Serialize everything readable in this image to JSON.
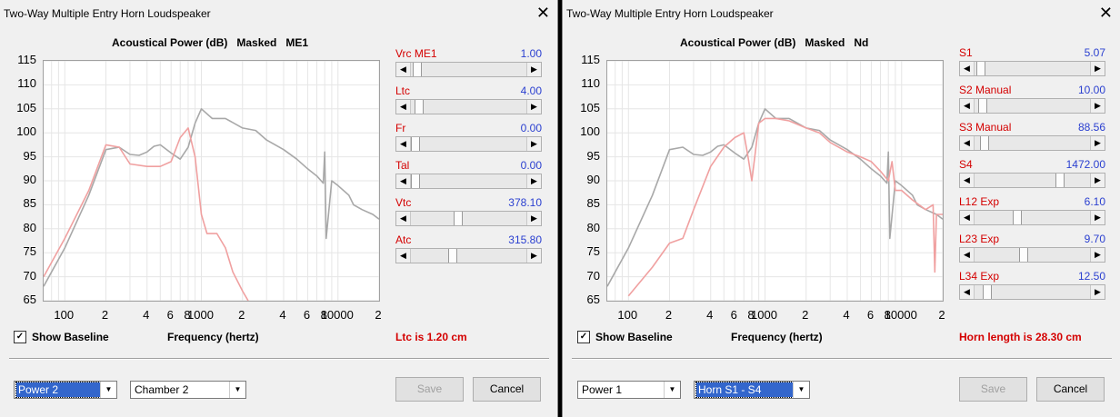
{
  "windows": [
    {
      "title": "Two-Way Multiple Entry Horn Loudspeaker",
      "chart_title": "Acoustical Power (dB)   Masked   ME1",
      "params": [
        {
          "label": "Vrc  ME1",
          "value": "1.00",
          "pos": 0.02
        },
        {
          "label": "Ltc",
          "value": "4.00",
          "pos": 0.03
        },
        {
          "label": "Fr",
          "value": "0.00",
          "pos": 0.0
        },
        {
          "label": "Tal",
          "value": "0.00",
          "pos": 0.0
        },
        {
          "label": "Vtc",
          "value": "378.10",
          "pos": 0.4
        },
        {
          "label": "Atc",
          "value": "315.80",
          "pos": 0.35
        }
      ],
      "show_baseline_label": "Show Baseline",
      "show_baseline_checked": true,
      "freq_label": "Frequency (hertz)",
      "status": "Ltc is 1.20 cm",
      "combo1": "Power 2",
      "combo2": "Chamber 2",
      "save_label": "Save",
      "cancel_label": "Cancel"
    },
    {
      "title": "Two-Way Multiple Entry Horn Loudspeaker",
      "chart_title": "Acoustical Power (dB)   Masked   Nd",
      "params": [
        {
          "label": "S1",
          "value": "5.07",
          "pos": 0.02
        },
        {
          "label": "S2  Manual",
          "value": "10.00",
          "pos": 0.03
        },
        {
          "label": "S3  Manual",
          "value": "88.56",
          "pos": 0.05
        },
        {
          "label": "S4",
          "value": "1472.00",
          "pos": 0.76
        },
        {
          "label": "L12  Exp",
          "value": "6.10",
          "pos": 0.36
        },
        {
          "label": "L23  Exp",
          "value": "9.70",
          "pos": 0.42
        },
        {
          "label": "L34  Exp",
          "value": "12.50",
          "pos": 0.08
        }
      ],
      "show_baseline_label": "Show Baseline",
      "show_baseline_checked": true,
      "freq_label": "Frequency (hertz)",
      "status": "Horn length is 28.30 cm",
      "combo1": "Power 1",
      "combo2": "Horn S1 - S4",
      "save_label": "Save",
      "cancel_label": "Cancel"
    }
  ],
  "chart_data": [
    {
      "type": "line",
      "title": "Acoustical Power (dB)   Masked   ME1",
      "xlabel": "Frequency (hertz)",
      "ylabel": "",
      "x_scale": "log",
      "xlim": [
        70,
        20000
      ],
      "ylim": [
        65,
        115
      ],
      "yticks": [
        115,
        110,
        105,
        100,
        95,
        90,
        85,
        80,
        75,
        70,
        65
      ],
      "xtick_labels": [
        "100",
        "2",
        "4",
        "6",
        "8",
        "1000",
        "2",
        "4",
        "6",
        "8",
        "10000",
        "2"
      ],
      "xtick_values": [
        100,
        200,
        400,
        600,
        800,
        1000,
        2000,
        4000,
        6000,
        8000,
        10000,
        20000
      ],
      "grid": true,
      "series": [
        {
          "color": "#a8a8a8",
          "x": [
            70,
            100,
            150,
            200,
            250,
            300,
            350,
            400,
            450,
            500,
            600,
            700,
            800,
            900,
            1000,
            1200,
            1500,
            2000,
            2500,
            3000,
            4000,
            5000,
            6000,
            7000,
            7800,
            8000,
            8200,
            9000,
            10000,
            12000,
            13000,
            15000,
            18000,
            20000
          ],
          "y": [
            68,
            76,
            87,
            96.5,
            97,
            95.5,
            95.3,
            96,
            97.2,
            97.5,
            95.8,
            94.5,
            97,
            102,
            105,
            103,
            103,
            101,
            100.5,
            98.5,
            96.5,
            94.5,
            92.5,
            91,
            89.5,
            96,
            78,
            90,
            89,
            87,
            85,
            84,
            83,
            82
          ]
        },
        {
          "color": "#f0a0a0",
          "x": [
            70,
            100,
            150,
            200,
            250,
            300,
            400,
            500,
            600,
            700,
            800,
            900,
            1000,
            1100,
            1300,
            1500,
            1700,
            2000,
            2200
          ],
          "y": [
            70,
            78,
            88,
            97.5,
            97,
            93.5,
            93,
            93,
            94,
            99,
            101,
            95,
            83,
            79,
            79,
            76,
            71,
            67,
            65
          ]
        }
      ]
    },
    {
      "type": "line",
      "title": "Acoustical Power (dB)   Masked   Nd",
      "xlabel": "Frequency (hertz)",
      "ylabel": "",
      "x_scale": "log",
      "xlim": [
        70,
        20000
      ],
      "ylim": [
        65,
        115
      ],
      "yticks": [
        115,
        110,
        105,
        100,
        95,
        90,
        85,
        80,
        75,
        70,
        65
      ],
      "xtick_labels": [
        "100",
        "2",
        "4",
        "6",
        "8",
        "1000",
        "2",
        "4",
        "6",
        "8",
        "10000",
        "2"
      ],
      "xtick_values": [
        100,
        200,
        400,
        600,
        800,
        1000,
        2000,
        4000,
        6000,
        8000,
        10000,
        20000
      ],
      "grid": true,
      "series": [
        {
          "color": "#a8a8a8",
          "x": [
            70,
            100,
            150,
            200,
            250,
            300,
            350,
            400,
            450,
            500,
            600,
            700,
            800,
            900,
            1000,
            1200,
            1500,
            2000,
            2500,
            3000,
            4000,
            5000,
            6000,
            7000,
            7800,
            8000,
            8200,
            9000,
            10000,
            12000,
            13000,
            15000,
            18000,
            20000
          ],
          "y": [
            68,
            76,
            87,
            96.5,
            97,
            95.5,
            95.3,
            96,
            97.2,
            97.5,
            95.8,
            94.5,
            97,
            102,
            105,
            103,
            103,
            101,
            100.5,
            98.5,
            96.5,
            94.5,
            92.5,
            91,
            89.5,
            96,
            78,
            90,
            89,
            87,
            85,
            84,
            83,
            82
          ]
        },
        {
          "color": "#f0a0a0",
          "x": [
            100,
            150,
            200,
            250,
            300,
            400,
            500,
            600,
            700,
            750,
            800,
            850,
            900,
            1000,
            1200,
            1500,
            2000,
            2500,
            3000,
            4000,
            5000,
            6000,
            7000,
            8000,
            8500,
            9000,
            10000,
            12000,
            15000,
            17000,
            17500,
            18000,
            20000
          ],
          "y": [
            66,
            72,
            77,
            78,
            84,
            93,
            97,
            99,
            100,
            95,
            90,
            96,
            102,
            103,
            103,
            102.5,
            101,
            100,
            98,
            96,
            95,
            94,
            92,
            90,
            94,
            88,
            88,
            86,
            84,
            85,
            71,
            83,
            83
          ]
        }
      ]
    }
  ]
}
